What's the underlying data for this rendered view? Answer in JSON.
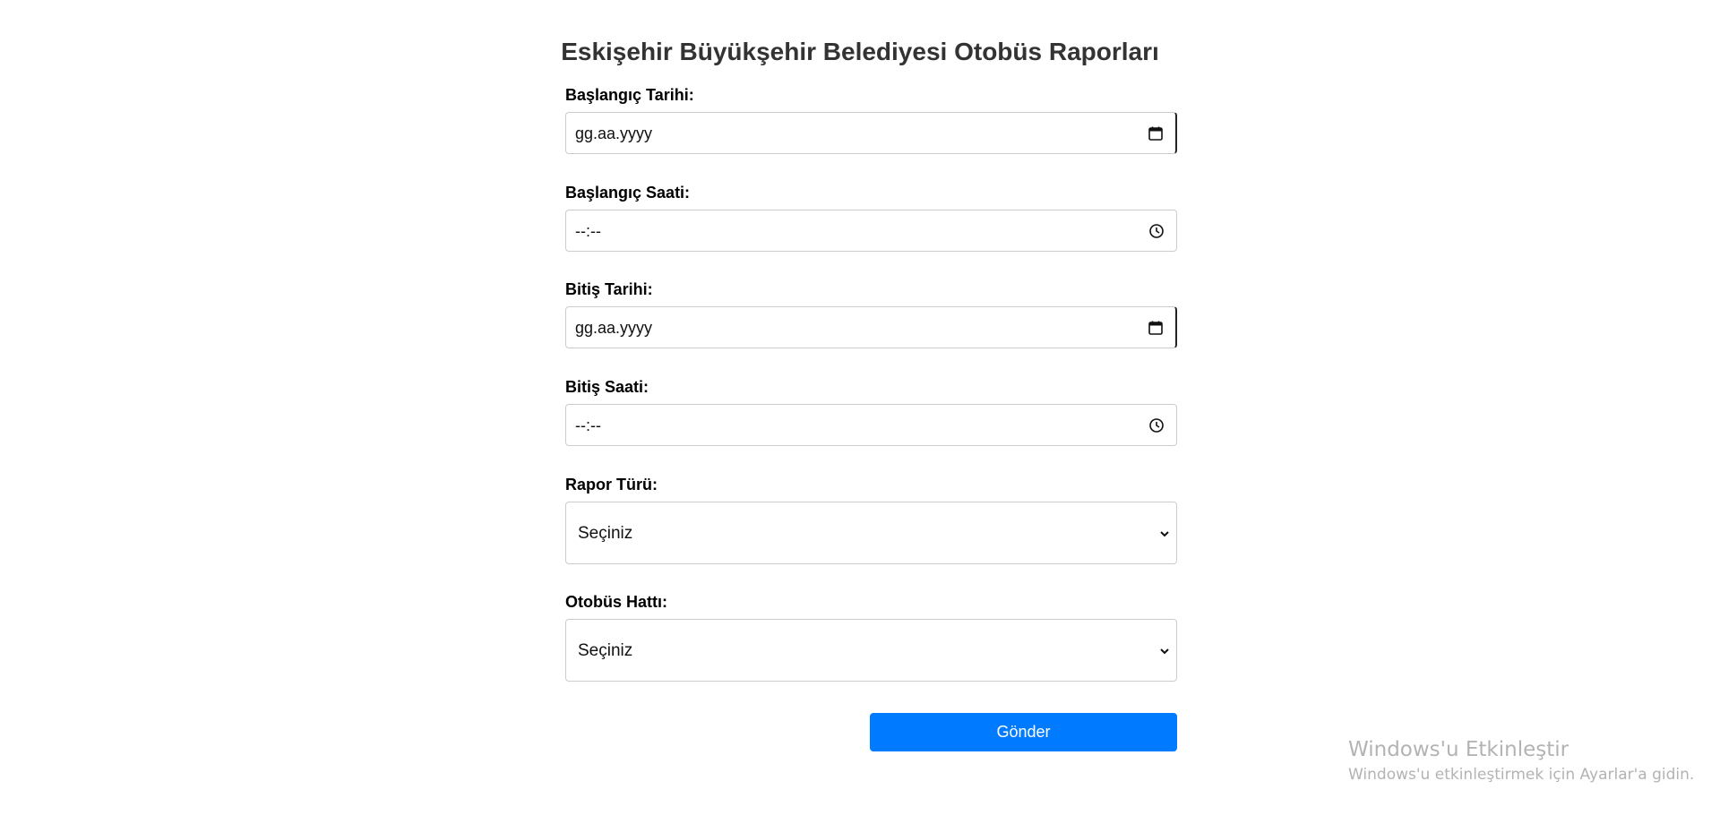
{
  "title": "Eskişehir Büyükşehir Belediyesi Otobüs Raporları",
  "form": {
    "start_date": {
      "label": "Başlangıç Tarihi:",
      "value": "gg.aa.yyyy",
      "icon": "calendar-icon"
    },
    "start_time": {
      "label": "Başlangıç Saati:",
      "value": "--:--",
      "icon": "clock-icon"
    },
    "end_date": {
      "label": "Bitiş Tarihi:",
      "value": "gg.aa.yyyy",
      "icon": "calendar-icon"
    },
    "end_time": {
      "label": "Bitiş Saati:",
      "value": "--:--",
      "icon": "clock-icon"
    },
    "report_type": {
      "label": "Rapor Türü:",
      "selected": "Seçiniz",
      "icon": "chevron-down-icon"
    },
    "bus_line": {
      "label": "Otobüs Hattı:",
      "selected": "Seçiniz",
      "icon": "chevron-down-icon"
    },
    "submit_label": "Gönder"
  },
  "watermark": {
    "title": "Windows'u Etkinleştir",
    "subtitle": "Windows'u etkinleştirmek için Ayarlar'a gidin."
  },
  "colors": {
    "accent": "#007bff",
    "title": "#333333",
    "border": "#cccccc",
    "watermark": "#b3b3b3"
  }
}
